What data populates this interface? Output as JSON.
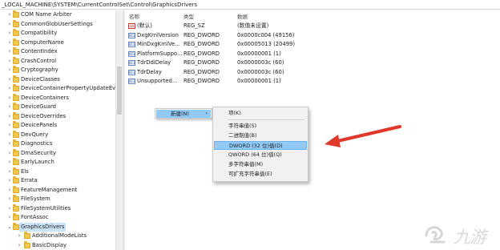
{
  "address_bar": {
    "path": "_LOCAL_MACHINE\\SYSTEM\\CurrentControlSet\\Control\\GraphicsDrivers"
  },
  "tree": {
    "items": [
      {
        "label": "COM Name Arbiter"
      },
      {
        "label": "CommonGlobUserSettings"
      },
      {
        "label": "Compatibility"
      },
      {
        "label": "ComputerName"
      },
      {
        "label": "ContentIndex"
      },
      {
        "label": "CrashControl"
      },
      {
        "label": "Cryptography"
      },
      {
        "label": "DeviceClasses"
      },
      {
        "label": "DeviceContainerPropertyUpdateEve"
      },
      {
        "label": "DeviceContainers"
      },
      {
        "label": "DeviceGuard"
      },
      {
        "label": "DeviceOverrides"
      },
      {
        "label": "DevicePanels"
      },
      {
        "label": "DevQuery"
      },
      {
        "label": "Diagnostics"
      },
      {
        "label": "DmaSecurity"
      },
      {
        "label": "EarlyLaunch"
      },
      {
        "label": "Els"
      },
      {
        "label": "Errata"
      },
      {
        "label": "FeatureManagement"
      },
      {
        "label": "FileSystem"
      },
      {
        "label": "FileSystemUtilities"
      },
      {
        "label": "FontAssoc"
      },
      {
        "label": "GraphicsDrivers"
      },
      {
        "label": "AdditionalModeLists"
      },
      {
        "label": "BasicDisplay"
      }
    ]
  },
  "columns": {
    "name": "名称",
    "type": "类型",
    "data": "数据"
  },
  "values": [
    {
      "icon": "ab",
      "name": "(默认)",
      "type": "REG_SZ",
      "data": "(数值未设置)"
    },
    {
      "icon": "011",
      "name": "DxgKrnlVersion",
      "type": "REG_DWORD",
      "data": "0x0000c004 (49156)"
    },
    {
      "icon": "011",
      "name": "MinDxgKrnlVe...",
      "type": "REG_DWORD",
      "data": "0x00005013 (20499)"
    },
    {
      "icon": "011",
      "name": "PlatformSuppo...",
      "type": "REG_DWORD",
      "data": "0x00000001 (1)"
    },
    {
      "icon": "011",
      "name": "TdrDdiDelay",
      "type": "REG_DWORD",
      "data": "0x0000003c (60)"
    },
    {
      "icon": "011",
      "name": "TdrDelay",
      "type": "REG_DWORD",
      "data": "0x0000003c (60)"
    },
    {
      "icon": "011",
      "name": "Unsupported...",
      "type": "REG_DWORD",
      "data": "0x00000001 (1)"
    }
  ],
  "context_menu": {
    "new_label": "新建(N)",
    "arrow": "›"
  },
  "submenu": {
    "items": [
      {
        "label": "项(K)"
      },
      {
        "label": "字符串值(S)"
      },
      {
        "label": "二进制值(B)"
      },
      {
        "label": "DWORD (32 位)值(D)"
      },
      {
        "label": "QWORD (64 位)值(Q)"
      },
      {
        "label": "多字符串值(M)"
      },
      {
        "label": "可扩充字符串值(E)"
      }
    ],
    "highlighted_index": 3
  },
  "watermark": {
    "text": "九游"
  },
  "colors": {
    "highlight": "#91c9f7",
    "selection": "#cce4f7",
    "arrow": "#e0392b",
    "folder": "#f1c84b"
  }
}
